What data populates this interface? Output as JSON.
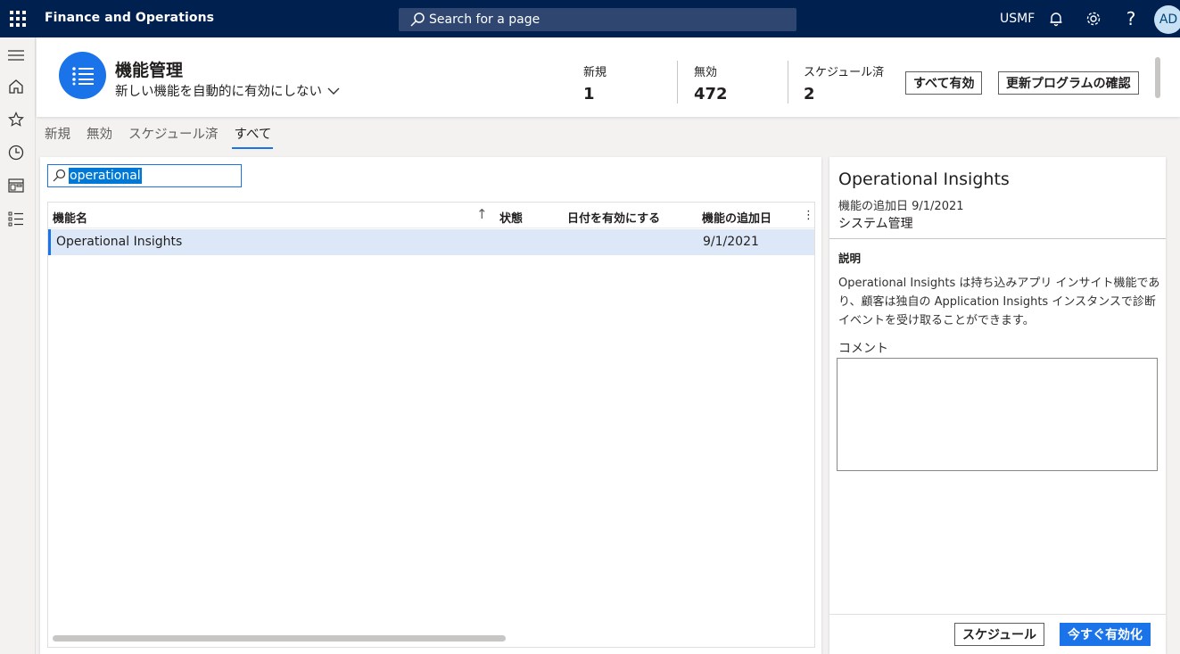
{
  "topbar": {
    "app_name": "Finance and Operations",
    "search_placeholder": "Search for a page",
    "company": "USMF",
    "avatar_initials": "AD"
  },
  "header": {
    "title": "機能管理",
    "subtitle": "新しい機能を自動的に有効にしない",
    "stats": [
      {
        "label": "新規",
        "value": "1"
      },
      {
        "label": "無効",
        "value": "472"
      },
      {
        "label": "スケジュール済",
        "value": "2"
      }
    ],
    "enable_all_label": "すべて有効",
    "check_updates_label": "更新プログラムの確認"
  },
  "tabs": [
    "新規",
    "無効",
    "スケジュール済",
    "すべて"
  ],
  "active_tab": "すべて",
  "filter": {
    "value": "operational"
  },
  "grid": {
    "columns": [
      "機能名",
      "状態",
      "日付を有効にする",
      "機能の追加日"
    ],
    "rows": [
      {
        "name": "Operational Insights",
        "state": "",
        "enable_date": "",
        "added_date": "9/1/2021"
      }
    ]
  },
  "detail": {
    "title": "Operational Insights",
    "added": "機能の追加日 9/1/2021",
    "module": "システム管理",
    "description_label": "説明",
    "description": "Operational Insights は持ち込みアプリ インサイト機能であり、顧客は独自の Application Insights インスタンスで診断イベントを受け取ることができます。",
    "comment_label": "コメント",
    "comment_value": "",
    "schedule_label": "スケジュール",
    "enable_now_label": "今すぐ有効化"
  },
  "colors": {
    "nav": "#002050",
    "accent": "#1a73e8",
    "row_selected": "#dce8f8"
  }
}
